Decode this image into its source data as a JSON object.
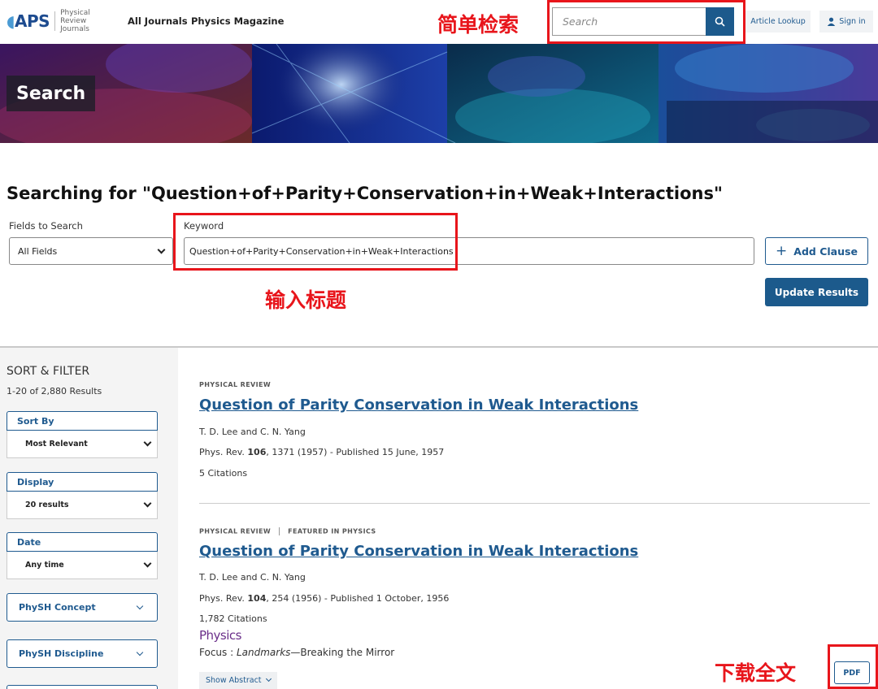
{
  "header": {
    "logo_text": "APS",
    "logo_sub": "Physical Review Journals",
    "nav": [
      "All Journals",
      "Physics Magazine"
    ],
    "search_placeholder": "Search",
    "article_lookup": "Article Lookup",
    "sign_in": "Sign in"
  },
  "annotations": {
    "simple_search": "简单检索",
    "enter_title": "输入标题",
    "download_full": "下载全文"
  },
  "banner": {
    "title": "Search"
  },
  "search_form": {
    "heading": "Searching for \"Question+of+Parity+Conservation+in+Weak+Interactions\"",
    "fields_label": "Fields to Search",
    "fields_value": "All Fields",
    "keyword_label": "Keyword",
    "keyword_value": "Question+of+Parity+Conservation+in+Weak+Interactions",
    "add_clause": "Add Clause",
    "update_results": "Update Results"
  },
  "sidebar": {
    "title": "SORT & FILTER",
    "count": "1-20 of 2,880 Results",
    "sort_by": {
      "label": "Sort By",
      "value": "Most Relevant"
    },
    "display": {
      "label": "Display",
      "value": "20 results"
    },
    "date": {
      "label": "Date",
      "value": "Any time"
    },
    "physh_concept": "PhySH Concept",
    "physh_discipline": "PhySH Discipline"
  },
  "results": [
    {
      "journal": "PHYSICAL REVIEW",
      "title": "Question of Parity Conservation in Weak Interactions",
      "authors": "T. D. Lee and C. N. Yang",
      "citation_prefix": "Phys. Rev. ",
      "volume": "106",
      "citation_suffix": ", 1371 (1957) - Published 15 June, 1957",
      "citations": "5 Citations"
    },
    {
      "journal": "PHYSICAL REVIEW",
      "featured": "FEATURED IN PHYSICS",
      "title": "Question of Parity Conservation in Weak Interactions",
      "authors": "T. D. Lee and C. N. Yang",
      "citation_prefix": "Phys. Rev. ",
      "volume": "104",
      "citation_suffix": ", 254 (1956) - Published 1 October, 1956",
      "citations": "1,782 Citations",
      "physics_logo": "Physics",
      "focus_prefix": "Focus : ",
      "focus_italic": "Landmarks",
      "focus_suffix": "—Breaking the Mirror",
      "show_abstract": "Show Abstract",
      "pdf": "PDF"
    }
  ],
  "colors": {
    "brand": "#1c5a8c",
    "link": "#1f5a8f",
    "annotation": "#e8151b"
  }
}
